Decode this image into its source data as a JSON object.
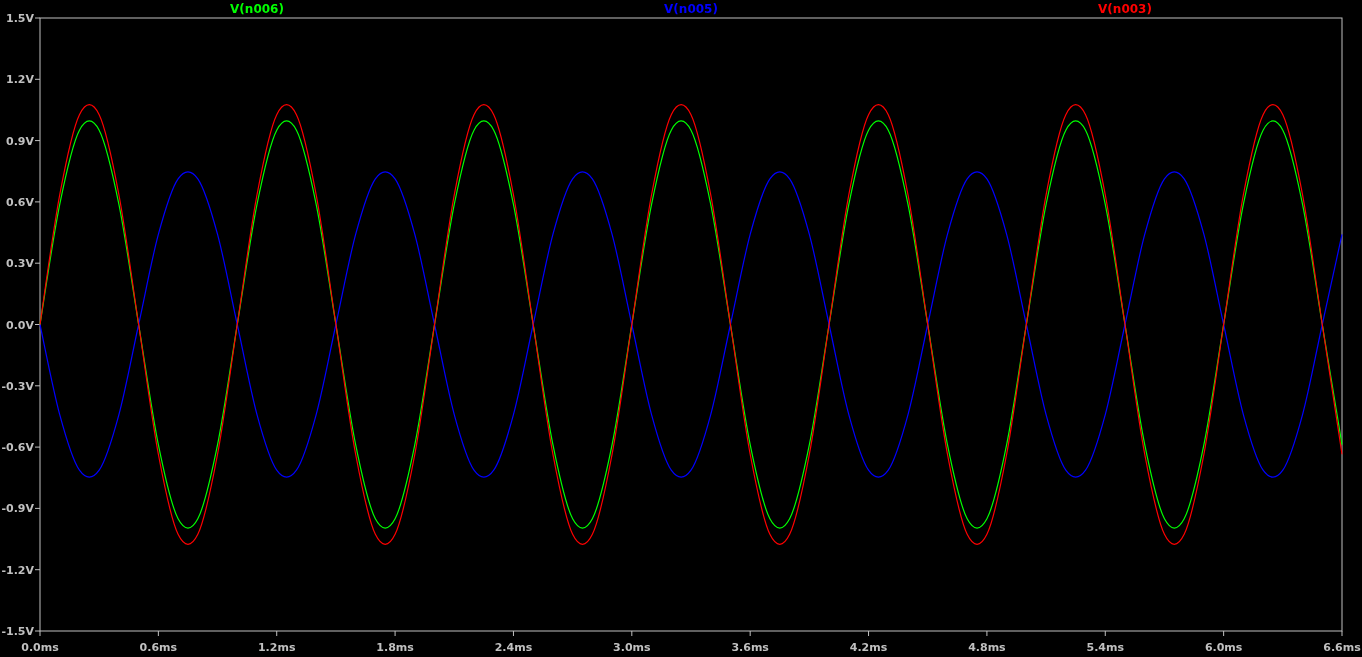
{
  "plot": {
    "chart_data": {
      "type": "line",
      "x": [
        0,
        0.1,
        0.2,
        0.3,
        0.4,
        0.5,
        0.6,
        0.7,
        0.8,
        0.9,
        1.0,
        1.1,
        1.2,
        1.3,
        1.4,
        1.5,
        1.6,
        1.7,
        1.8,
        1.9,
        2.0,
        2.1,
        2.2,
        2.3,
        2.4,
        2.5,
        2.6,
        2.7,
        2.8,
        2.9,
        3.0,
        3.1,
        3.2,
        3.3,
        3.4,
        3.5,
        3.6,
        3.7,
        3.8,
        3.9,
        4.0,
        4.1,
        4.2,
        4.3,
        4.4,
        4.5,
        4.6,
        4.7,
        4.8,
        4.9,
        5.0,
        5.1,
        5.2,
        5.3,
        5.4,
        5.5,
        5.6,
        5.7,
        5.8,
        5.9,
        6.0,
        6.1,
        6.2,
        6.3,
        6.4,
        6.5,
        6.6
      ],
      "series": [
        {
          "name": "V(n006)",
          "color": "#00ff00",
          "values": [
            0,
            0.588,
            0.951,
            0.951,
            0.588,
            0,
            -0.588,
            -0.951,
            -0.951,
            -0.588,
            0,
            0.588,
            0.951,
            0.951,
            0.588,
            0,
            -0.588,
            -0.951,
            -0.951,
            -0.588,
            0,
            0.588,
            0.951,
            0.951,
            0.588,
            0,
            -0.588,
            -0.951,
            -0.951,
            -0.588,
            0,
            0.588,
            0.951,
            0.951,
            0.588,
            0,
            -0.588,
            -0.951,
            -0.951,
            -0.588,
            0,
            0.588,
            0.951,
            0.951,
            0.588,
            0,
            -0.588,
            -0.951,
            -0.951,
            -0.588,
            0,
            0.588,
            0.951,
            0.951,
            0.588,
            0,
            -0.588,
            -0.951,
            -0.951,
            -0.588,
            0,
            0.588,
            0.951,
            0.951,
            0.588,
            0,
            -0.588
          ]
        },
        {
          "name": "V(n005)",
          "color": "#0000ff",
          "values": [
            0,
            -0.441,
            -0.713,
            -0.713,
            -0.441,
            0,
            0.441,
            0.713,
            0.713,
            0.441,
            0,
            -0.441,
            -0.713,
            -0.713,
            -0.441,
            0,
            0.441,
            0.713,
            0.713,
            0.441,
            0,
            -0.441,
            -0.713,
            -0.713,
            -0.441,
            0,
            0.441,
            0.713,
            0.713,
            0.441,
            0,
            -0.441,
            -0.713,
            -0.713,
            -0.441,
            0,
            0.441,
            0.713,
            0.713,
            0.441,
            0,
            -0.441,
            -0.713,
            -0.713,
            -0.441,
            0,
            0.441,
            0.713,
            0.713,
            0.441,
            0,
            -0.441,
            -0.713,
            -0.713,
            -0.441,
            0,
            0.441,
            0.713,
            0.713,
            0.441,
            0,
            -0.441,
            -0.713,
            -0.713,
            -0.441,
            0,
            0.441
          ]
        },
        {
          "name": "V(n003)",
          "color": "#ff0000",
          "values": [
            0,
            0.635,
            1.027,
            1.027,
            0.635,
            0,
            -0.635,
            -1.027,
            -1.027,
            -0.635,
            0,
            0.635,
            1.027,
            1.027,
            0.635,
            0,
            -0.635,
            -1.027,
            -1.027,
            -0.635,
            0,
            0.635,
            1.027,
            1.027,
            0.635,
            0,
            -0.635,
            -1.027,
            -1.027,
            -0.635,
            0,
            0.635,
            1.027,
            1.027,
            0.635,
            0,
            -0.635,
            -1.027,
            -1.027,
            -0.635,
            0,
            0.635,
            1.027,
            1.027,
            0.635,
            0,
            -0.635,
            -1.027,
            -1.027,
            -0.635,
            0,
            0.635,
            1.027,
            1.027,
            0.635,
            0,
            -0.635,
            -1.027,
            -1.027,
            -0.635,
            0,
            0.635,
            1.027,
            1.027,
            0.635,
            0,
            -0.635
          ]
        }
      ],
      "xlim": [
        0,
        6.6
      ],
      "ylim": [
        -1.5,
        1.5
      ],
      "xticks": [
        {
          "value": 0,
          "label": "0.0ms"
        },
        {
          "value": 0.6,
          "label": "0.6ms"
        },
        {
          "value": 1.2,
          "label": "1.2ms"
        },
        {
          "value": 1.8,
          "label": "1.8ms"
        },
        {
          "value": 2.4,
          "label": "2.4ms"
        },
        {
          "value": 3.0,
          "label": "3.0ms"
        },
        {
          "value": 3.6,
          "label": "3.6ms"
        },
        {
          "value": 4.2,
          "label": "4.2ms"
        },
        {
          "value": 4.8,
          "label": "4.8ms"
        },
        {
          "value": 5.4,
          "label": "5.4ms"
        },
        {
          "value": 6.0,
          "label": "6.0ms"
        },
        {
          "value": 6.6,
          "label": "6.6ms"
        }
      ],
      "yticks": [
        {
          "value": 1.5,
          "label": "1.5V"
        },
        {
          "value": 1.2,
          "label": "1.2V"
        },
        {
          "value": 0.9,
          "label": "0.9V"
        },
        {
          "value": 0.6,
          "label": "0.6V"
        },
        {
          "value": 0.3,
          "label": "0.3V"
        },
        {
          "value": 0,
          "label": "0.0V"
        },
        {
          "value": -0.3,
          "label": "-0.3V"
        },
        {
          "value": -0.6,
          "label": "-0.6V"
        },
        {
          "value": -0.9,
          "label": "-0.9V"
        },
        {
          "value": -1.2,
          "label": "-1.2V"
        },
        {
          "value": -1.5,
          "label": "-1.5V"
        }
      ]
    }
  }
}
